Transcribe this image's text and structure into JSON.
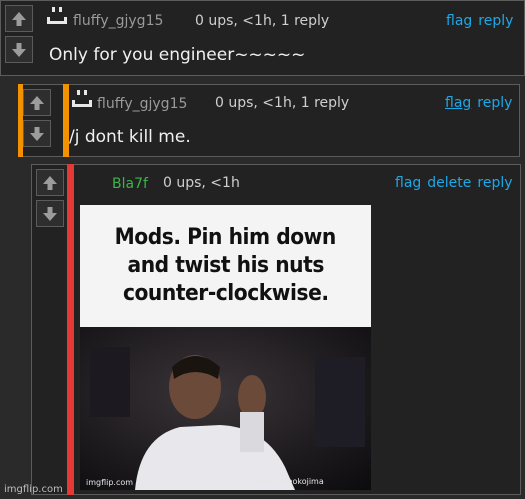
{
  "colors": {
    "accent_link": "#1fa7e6",
    "username_default": "#9a9a9a",
    "username_green": "#3ab54a",
    "bar_orange": "#f39200",
    "bar_red": "#e53935"
  },
  "comments": [
    {
      "username": "fluffy_gjyg15",
      "meta": "0 ups, <1h, 1 reply",
      "actions": [
        "flag",
        "reply"
      ],
      "text": "Only for you engineer~~~~~",
      "icons": [
        "upvote-arrow-icon",
        "downvote-arrow-icon",
        "avatar-smiley-icon"
      ]
    },
    {
      "username": "fluffy_gjyg15",
      "meta": "0 ups, <1h, 1 reply",
      "actions": [
        "flag",
        "reply"
      ],
      "text": "/j dont kill me.",
      "icons": [
        "upvote-arrow-icon",
        "downvote-arrow-icon",
        "avatar-smiley-icon"
      ]
    },
    {
      "username": "Bla7f",
      "meta": "0 ups, <1h",
      "actions": [
        "flag",
        "delete",
        "reply"
      ],
      "meme": {
        "lines": [
          "Mods. Pin him down",
          "and twist his nuts",
          "counter-clockwise."
        ],
        "watermark_left": "imgflip.com",
        "watermark_right": "@realhideokojima"
      }
    }
  ],
  "footer": {
    "imgflip": "imgflip.com"
  }
}
